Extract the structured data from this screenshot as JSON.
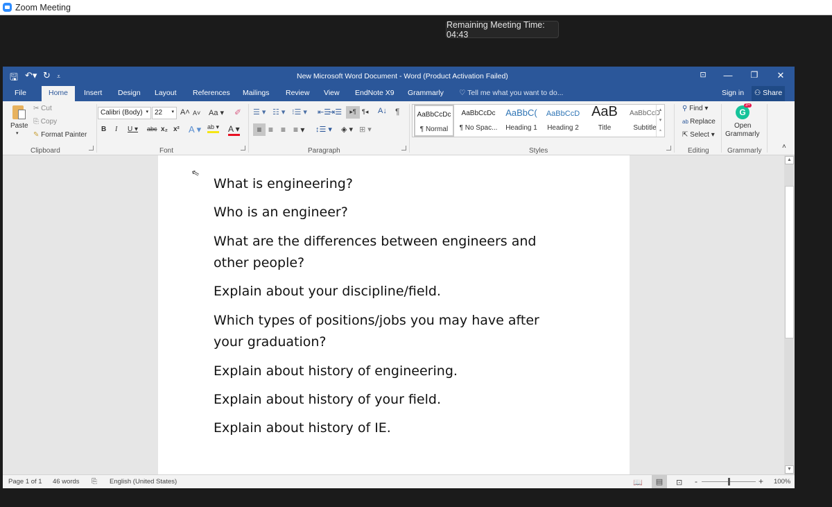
{
  "zoom_window": {
    "title": "Zoom Meeting",
    "timer": "Remaining Meeting Time: 04:43"
  },
  "word": {
    "title": "New Microsoft Word Document - Word (Product Activation Failed)",
    "qat": {
      "save_icon": "save-icon",
      "undo_icon": "undo-icon",
      "redo_icon": "redo-icon",
      "customize_icon": "customize-qat-icon"
    },
    "tabs": [
      "File",
      "Home",
      "Insert",
      "Design",
      "Layout",
      "References",
      "Mailings",
      "Review",
      "View",
      "EndNote X9",
      "Grammarly"
    ],
    "active_tab": "Home",
    "tell_me": "Tell me what you want to do...",
    "sign_in": "Sign in",
    "share": "Share",
    "ribbon": {
      "clipboard": {
        "paste": "Paste",
        "cut": "Cut",
        "copy": "Copy",
        "format_painter": "Format Painter",
        "label": "Clipboard"
      },
      "font": {
        "name": "Calibri (Body)",
        "size": "22",
        "label": "Font"
      },
      "paragraph": {
        "label": "Paragraph"
      },
      "styles": {
        "items": [
          {
            "preview": "AaBbCcDc",
            "name": "¶ Normal"
          },
          {
            "preview": "AaBbCcDc",
            "name": "¶ No Spac..."
          },
          {
            "preview": "AaBbC(",
            "name": "Heading 1"
          },
          {
            "preview": "AaBbCcD",
            "name": "Heading 2"
          },
          {
            "preview": "AaB",
            "name": "Title"
          },
          {
            "preview": "AaBbCcD",
            "name": "Subtitle"
          }
        ],
        "label": "Styles"
      },
      "editing": {
        "find": "Find",
        "replace": "Replace",
        "select": "Select",
        "label": "Editing"
      },
      "grammarly": {
        "open": "Open",
        "open2": "Grammarly",
        "label": "Grammarly",
        "badge": "3+"
      }
    },
    "document": {
      "paragraphs": [
        [
          "What is engineering?"
        ],
        [
          "Who is an engineer?"
        ],
        [
          "What are the differences between engineers and",
          "other people?"
        ],
        [
          "Explain about your discipline/field."
        ],
        [
          "Which types of positions/jobs you may have after",
          "your graduation?"
        ],
        [
          "Explain about history of engineering."
        ],
        [
          "Explain about history of your field."
        ],
        [
          "Explain about history of IE."
        ]
      ]
    },
    "status": {
      "page": "Page 1 of 1",
      "words": "46 words",
      "language": "English (United States)",
      "zoom": "100%",
      "zoom_percent": 100
    },
    "colors": {
      "accent": "#2b579a",
      "ribbon": "#f3f3f3"
    }
  }
}
